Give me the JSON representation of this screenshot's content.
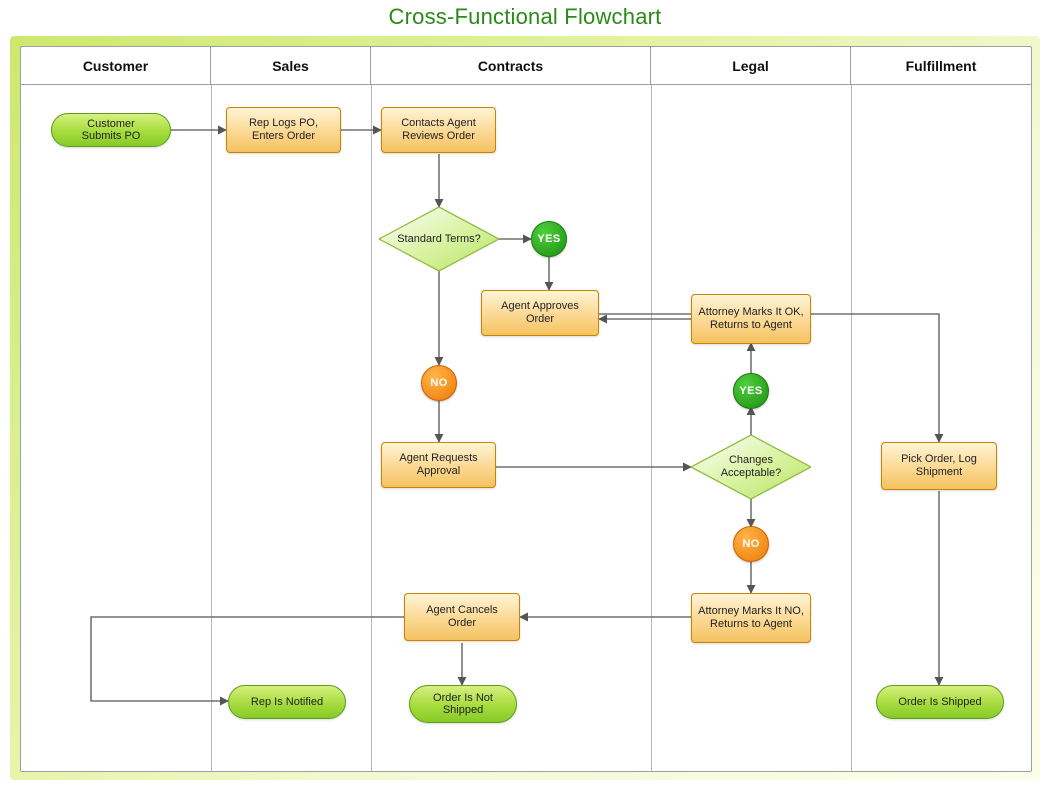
{
  "title": "Cross-Functional Flowchart",
  "lanes": {
    "l0": "Customer",
    "l1": "Sales",
    "l2": "Contracts",
    "l3": "Legal",
    "l4": "Fulfillment"
  },
  "shapes": {
    "start": "Customer Submits PO",
    "logpo": "Rep Logs PO, Enters Order",
    "review": "Contacts Agent Reviews Order",
    "stdterms": "Standard Terms?",
    "approves": "Agent Approves Order",
    "requests": "Agent Requests Approval",
    "changes": "Changes Acceptable?",
    "attok": "Attorney Marks It OK, Returns to Agent",
    "attno": "Attorney Marks It NO, Returns to Agent",
    "cancel": "Agent Cancels Order",
    "pick": "Pick Order, Log Shipment",
    "repnotified": "Rep Is Notified",
    "notshipped": "Order Is Not Shipped",
    "shipped": "Order Is Shipped"
  },
  "labels": {
    "yes": "YES",
    "no": "NO"
  }
}
